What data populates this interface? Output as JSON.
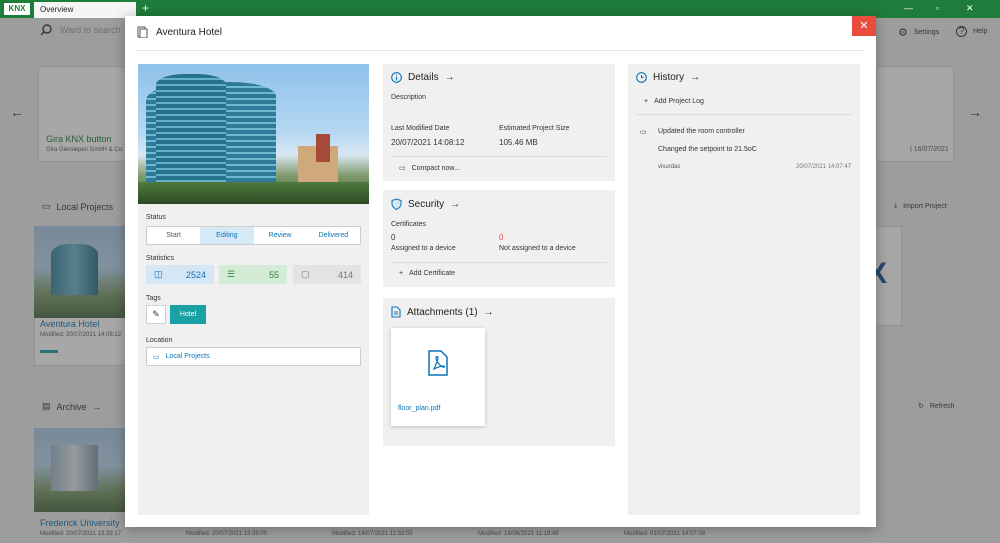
{
  "titlebar": {
    "logo": "KNX",
    "tab": "Overview",
    "add": "+"
  },
  "toolbar": {
    "search_placeholder": "Ward to search",
    "settings": "Settings",
    "help": "Help"
  },
  "background": {
    "card1": {
      "title": "Gira KNX button",
      "subtitle": "Gira Giersiepen GmbH & Co.",
      "date_partial": "| 16/07/2021"
    },
    "local_projects": "Local Projects",
    "import_project": "Import Project",
    "project_title": "Aventura Hotel",
    "project_modified": "Modified: 20/07/2021 14:08:12",
    "archive": "Archive",
    "refresh": "Refresh",
    "archive_title": "Frederick University",
    "archive_items": [
      "Modified: 20/07/2021 13:39:17",
      "Modified: 20/07/2021 13:38:00",
      "Modified: 14/07/2021 11:33:55",
      "Modified: 18/06/2021 11:18:49",
      "Modified: 01/07/2021 14:07:08"
    ]
  },
  "modal": {
    "title": "Aventura Hotel",
    "close": "✕",
    "left": {
      "status_label": "Status",
      "steps": [
        "Start",
        "Editing",
        "Review",
        "Delivered"
      ],
      "statistics_label": "Statistics",
      "stats": [
        "2524",
        "55",
        "414"
      ],
      "tags_label": "Tags",
      "tag": "Hotel",
      "location_label": "Location",
      "location": "Local Projects"
    },
    "details": {
      "title": "Details",
      "description_label": "Description",
      "last_modified_label": "Last Modified Date",
      "last_modified": "20/07/2021 14:08:12",
      "size_label": "Estimated Project Size",
      "size": "105.46 MB",
      "compact": "Compact now..."
    },
    "security": {
      "title": "Security",
      "certificates_label": "Certificates",
      "assigned_count": "0",
      "assigned_label": "Assigned to a device",
      "not_assigned_count": "0",
      "not_assigned_label": "Not assigned to a device",
      "add_certificate": "Add Certificate"
    },
    "attachments": {
      "title": "Attachments (1)",
      "file": "floor_plan.pdf"
    },
    "history": {
      "title": "History",
      "add_log": "Add Project Log",
      "entry_title": "Updated the room controller",
      "entry_text": "Changed the setpoint to 21.5oC",
      "entry_user": "visurdas",
      "entry_date": "20/07/2021 14:07:47"
    }
  },
  "colors": {
    "accent": "#0b73b8",
    "brand": "#1f7d3b",
    "tag": "#1aa1a5",
    "close": "#e74c3c"
  }
}
